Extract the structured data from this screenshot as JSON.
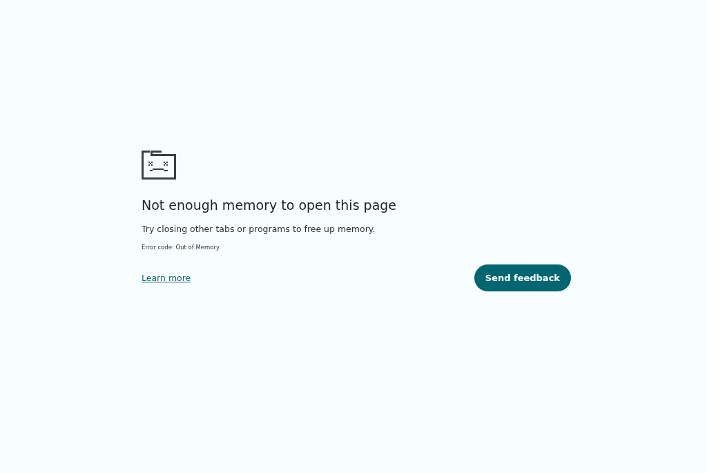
{
  "heading": "Not enough memory to open this page",
  "message": "Try closing other tabs or programs to free up memory.",
  "error_code": "Error code: Out of Memory",
  "link": "Learn more",
  "button": "Send feedback"
}
